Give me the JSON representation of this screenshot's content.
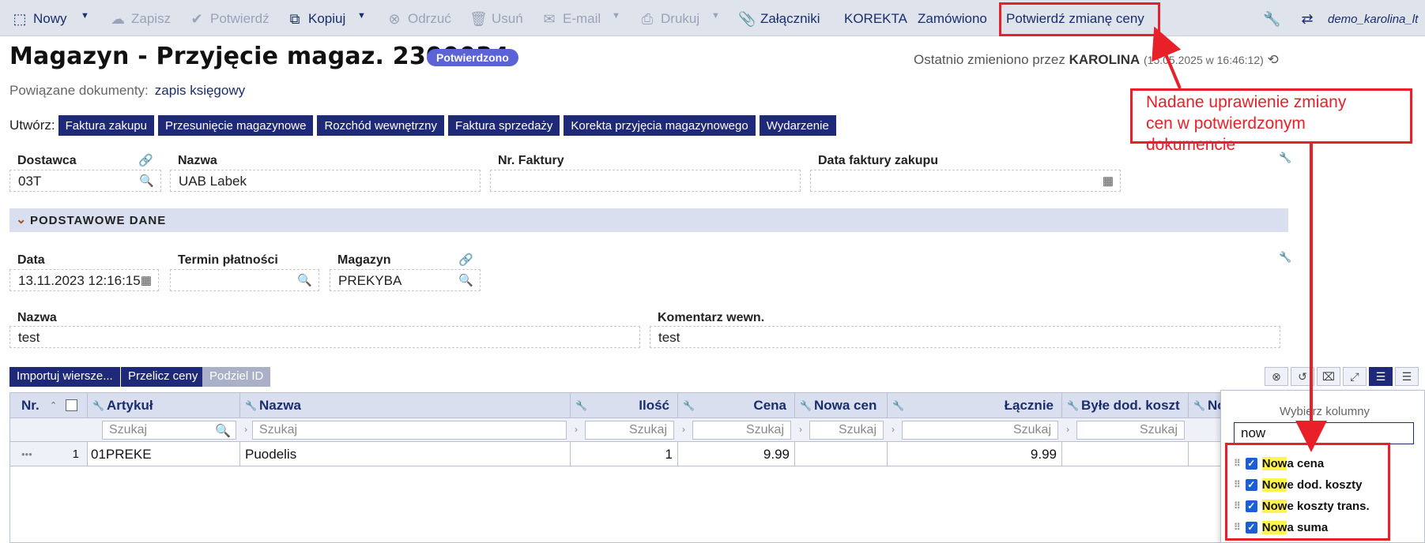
{
  "toolbar": {
    "new": "Nowy",
    "save": "Zapisz",
    "confirm": "Potwierdź",
    "copy": "Kopiuj",
    "reject": "Odrzuć",
    "delete": "Usuń",
    "email": "E-mail",
    "print": "Drukuj",
    "attachments": "Załączniki",
    "correction": "KOREKTA",
    "ordered": "Zamówiono",
    "confirm_price_change": "Potwierdź zmianę ceny",
    "user": "demo_karolina_lt"
  },
  "header": {
    "title": "Magazyn - Przyjęcie magaz. 2300034",
    "status_badge": "Potwierdzono",
    "last_changed_prefix": "Ostatnio zmieniono przez",
    "last_changed_user": "KAROLINA",
    "last_changed_date": "(15.05.2025 w 16:46:12)"
  },
  "related": {
    "label": "Powiązane dokumenty:",
    "link": "zapis księgowy"
  },
  "create": {
    "label": "Utwórz:",
    "buttons": [
      "Faktura zakupu",
      "Przesunięcie magazynowe",
      "Rozchód wewnętrzny",
      "Faktura sprzedaży",
      "Korekta przyjęcia magazynowego",
      "Wydarzenie"
    ]
  },
  "form": {
    "supplier_label": "Dostawca",
    "supplier_value": "03T",
    "name_label": "Nazwa",
    "name_value": "UAB Labek",
    "invoice_no_label": "Nr. Faktury",
    "invoice_no_value": "",
    "invoice_date_label": "Data faktury zakupu",
    "invoice_date_value": ""
  },
  "section": {
    "title": "PODSTAWOWE DANE"
  },
  "basic": {
    "date_label": "Data",
    "date_value": "13.11.2023 12:16:15",
    "payment_label": "Termin płatności",
    "payment_value": "",
    "warehouse_label": "Magazyn",
    "warehouse_value": "PREKYBA",
    "name_label": "Nazwa",
    "name_value": "test",
    "comment_label": "Komentarz wewn.",
    "comment_value": "test"
  },
  "grid_buttons": {
    "import": "Importuj wiersze...",
    "recalc": "Przelicz ceny",
    "split": "Podziel ID"
  },
  "grid": {
    "headers": [
      "Nr.",
      "Artykuł",
      "Nazwa",
      "Ilość",
      "Cena",
      "Nowa cen",
      "Łącznie",
      "Byłe dod. koszt",
      "No"
    ],
    "search_placeholder": "Szukaj",
    "rows": [
      {
        "nr": "1",
        "article": "01PREKE",
        "name": "Puodelis",
        "qty": "1",
        "price": "9.99",
        "new_price": "",
        "total": "9.99",
        "old_cost": ""
      }
    ]
  },
  "chooser": {
    "title": "Wybierz kolumny",
    "search_value": "now",
    "items": [
      {
        "match": "Now",
        "rest": "a cena"
      },
      {
        "match": "Now",
        "rest": "e dod. koszty"
      },
      {
        "match": "Now",
        "rest": "e koszty trans."
      },
      {
        "match": "Now",
        "rest": "a suma"
      }
    ]
  },
  "annotation": {
    "text": "Nadane uprawienie zmiany cen w potwierdzonym dokumencie",
    "color": "#e8202a"
  },
  "colors": {
    "accent": "#1e2a78",
    "badge": "#5b63d6",
    "toolbar_bg": "#dfe3ec",
    "section_bg": "#d9dfee"
  }
}
